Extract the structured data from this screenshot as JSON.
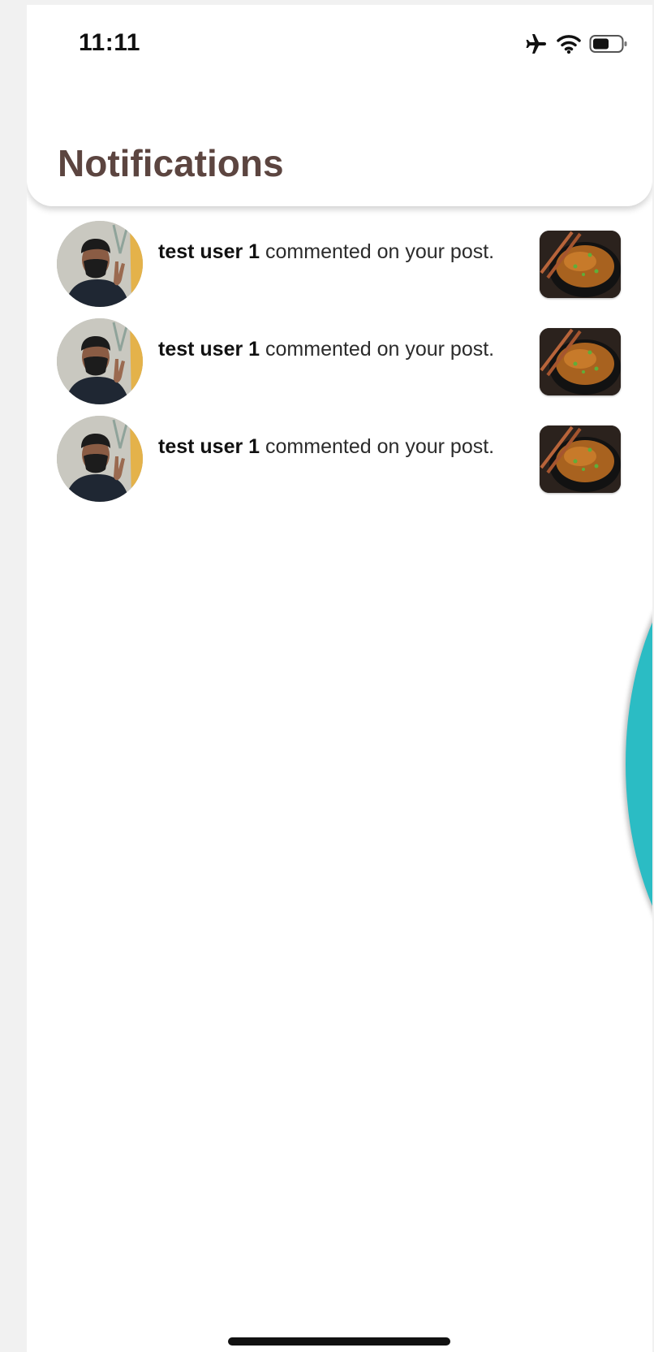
{
  "status_bar": {
    "time": "11:11",
    "icons": [
      "airplane-icon",
      "wifi-icon",
      "battery-icon"
    ]
  },
  "header": {
    "title": "Notifications"
  },
  "notifications": [
    {
      "user": "test user 1",
      "action": "commented on your post."
    },
    {
      "user": "test user 1",
      "action": "commented on your post."
    },
    {
      "user": "test user 1",
      "action": "commented on your post."
    }
  ],
  "colors": {
    "title": "#5c4540",
    "accent_teal": "#2bbcc4",
    "background": "#ffffff"
  }
}
